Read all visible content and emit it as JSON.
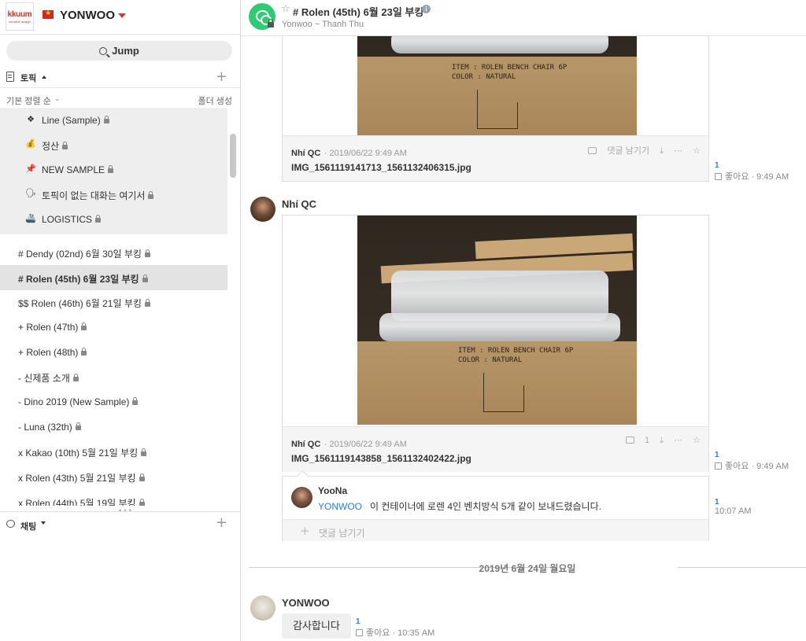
{
  "team": {
    "logo_text": "kkuum",
    "logo_sub": "sensible design",
    "name": "YONWOO"
  },
  "sidebar": {
    "jump_label": "Jump",
    "topic_section_label": "토픽",
    "sort_label": "기본 정렬 순",
    "folder_create_label": "폴더 생성",
    "chat_section_label": "채팅",
    "folder_items": [
      {
        "icon": "❖",
        "label": "Line (Sample)"
      },
      {
        "icon": "💰",
        "label": "정산"
      },
      {
        "icon": "📌",
        "label": "NEW SAMPLE"
      },
      {
        "icon": "🗣",
        "label": "토픽이 없는 대화는 여기서"
      },
      {
        "icon": "🚢",
        "label": "LOGISTICS"
      }
    ],
    "topics": [
      {
        "label": "# Dendy (02nd) 6월 30일 부킹"
      },
      {
        "label": "# Rolen (45th) 6월 23일 부킹"
      },
      {
        "label": "$$ Rolen (46th) 6월 21일 부킹"
      },
      {
        "label": "+ Rolen (47th)"
      },
      {
        "label": "+ Rolen (48th)"
      },
      {
        "label": "- 신제품 소개"
      },
      {
        "label": "- Dino 2019 (New Sample)"
      },
      {
        "label": "- Luna (32th)"
      },
      {
        "label": "x Kakao (10th) 5월 21일 부킹"
      },
      {
        "label": "x Rolen (43th) 5월 21일 부킹"
      },
      {
        "label": "x Rolen (44th) 5월 19일 부킹"
      }
    ]
  },
  "room": {
    "title": "# Rolen (45th) 6월 23일 부킹",
    "subtitle": "Yonwoo ~ Thanh Thu"
  },
  "messages": {
    "first_card": {
      "sender": "Nhí QC",
      "time": "· 2019/06/22 9:49 AM",
      "filename": "IMG_1561119141713_1561132406315.jpg",
      "comment_action": "댓글 남기기",
      "box_text_1": "ITEM : ROLEN BENCH CHAIR 6P",
      "box_text_2": "COLOR : NATURAL",
      "unread": "1",
      "like": "좋아요",
      "side_time": "9:49 AM"
    },
    "second": {
      "sender": "Nhí QC",
      "card_sender": "Nhí QC",
      "card_time": "· 2019/06/22 9:49 AM",
      "filename": "IMG_1561119143858_1561132402422.jpg",
      "comment_count": "1",
      "box_text_1": "ITEM : ROLEN BENCH CHAIR 6P",
      "box_text_2": "COLOR : NATURAL",
      "unread": "1",
      "like": "좋아요",
      "side_time": "9:49 AM"
    },
    "reply": {
      "name": "YooNa",
      "mention": "YONWOO",
      "text": "이 컨테이너에 로렌 4인 벤치방식 5개 같이 보내드렸습니다.",
      "unread": "1",
      "time": "10:07 AM",
      "input_placeholder": "댓글 남기기"
    },
    "date_divider": "2019년 6월 24일 월요일",
    "last": {
      "sender": "YONWOO",
      "text": "감사합니다",
      "unread": "1",
      "like": "좋아요",
      "time": "· 10:35 AM"
    }
  },
  "colors": {
    "room_avatar": "#2ecc71",
    "accent_blue": "#2d7de0",
    "team_caret": "#e1322d"
  }
}
